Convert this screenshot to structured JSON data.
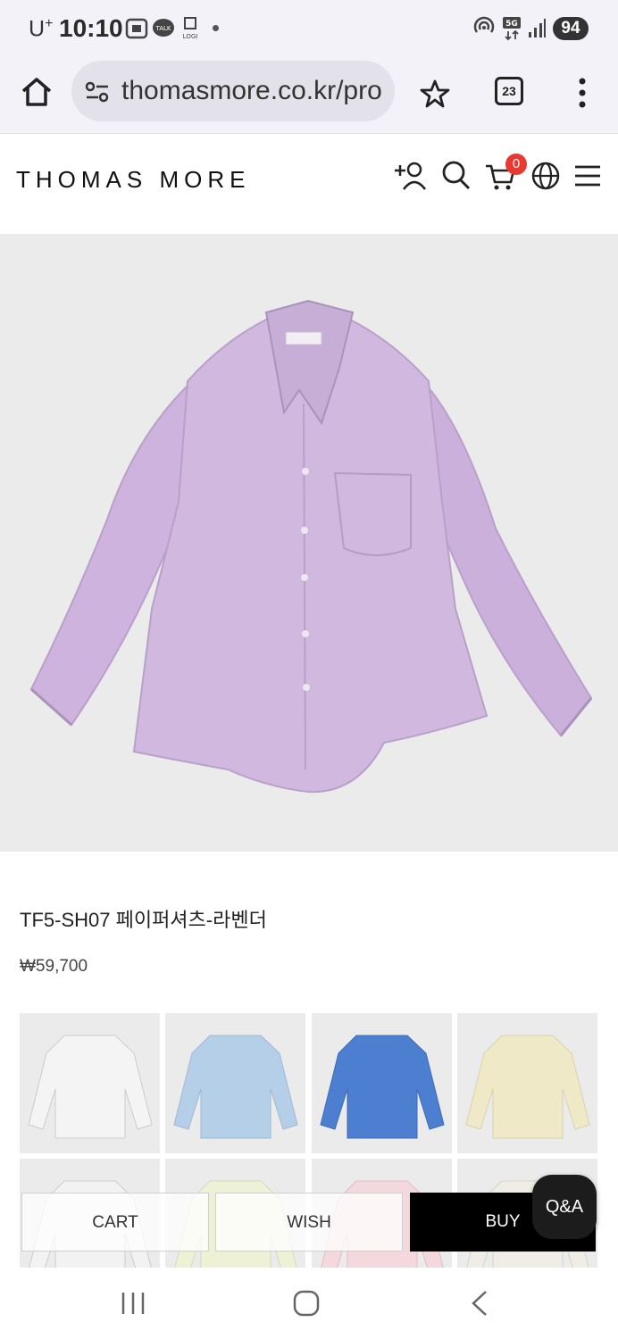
{
  "status_bar": {
    "carrier": "U",
    "carrier_sup": "+",
    "time": "10:10",
    "network": "5G",
    "battery": "94"
  },
  "browser": {
    "url": "thomasmore.co.kr/pro",
    "tab_count": "23"
  },
  "site": {
    "logo": "THOMAS MORE",
    "cart_count": "0"
  },
  "product": {
    "title": "TF5-SH07 페이퍼셔츠-라벤더",
    "price": "₩59,700",
    "swatches": [
      {
        "color": "#f4f4f4"
      },
      {
        "color": "#b5cfe8"
      },
      {
        "color": "#4d7fd0"
      },
      {
        "color": "#efe9c8"
      },
      {
        "color": "#f2f2f2"
      },
      {
        "color": "#eef1d6"
      },
      {
        "color": "#f3d9dd"
      },
      {
        "color": "#efede6"
      }
    ]
  },
  "actions": {
    "cart": "CART",
    "wish": "WISH",
    "buy": "BUY",
    "qa": "Q&A"
  },
  "colors": {
    "shirt": "#cdb4dc",
    "accent_badge": "#e8382f"
  }
}
